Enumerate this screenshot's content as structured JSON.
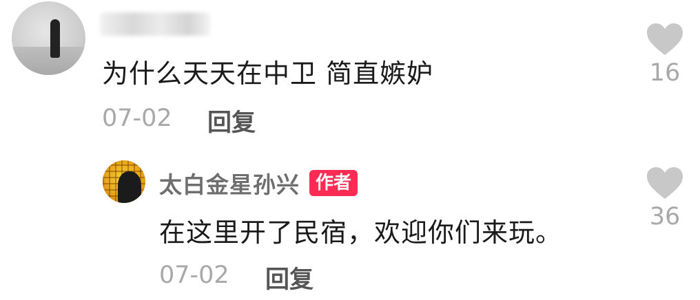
{
  "comment": {
    "text": "为什么天天在中卫 简直嫉妒",
    "date": "07-02",
    "reply_label": "回复",
    "like_count": "16"
  },
  "reply": {
    "username": "太白金星孙兴",
    "author_badge": "作者",
    "text": "在这里开了民宿，欢迎你们来玩。",
    "date": "07-02",
    "reply_label": "回复",
    "like_count": "36"
  },
  "colors": {
    "badge": "#fe2c55",
    "heart": "#c8c8c8",
    "meta": "#a8a8a8"
  },
  "icons": [
    "heart-icon"
  ]
}
